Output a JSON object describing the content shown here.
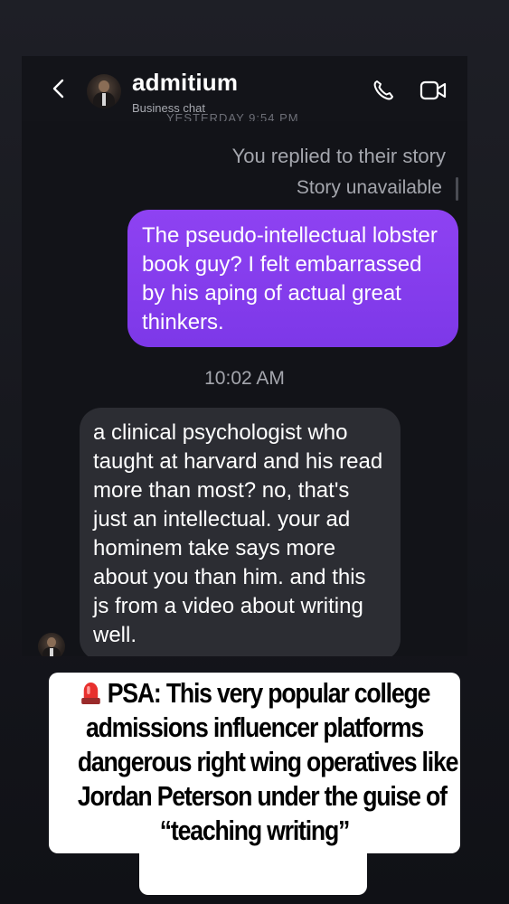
{
  "header": {
    "title": "admitium",
    "subtitle": "Business chat",
    "clipped_date": "YESTERDAY 9:54 PM"
  },
  "thread": {
    "reply_note": "You replied to their story",
    "story_status": "Story unavailable",
    "outgoing_message": "The pseudo-intellectual lobster book guy? I felt embarrassed by his aping of actual great thinkers.",
    "timestamp": "10:02 AM",
    "incoming_message": "a clinical psychologist who taught at harvard and his read more than most? no, that's just an intellectual. your ad hominem take says more about you than him. and this js from a video about writing well."
  },
  "caption": {
    "lines": [
      "PSA: This very popular college",
      "admissions influencer platforms",
      "dangerous right wing  operatives like",
      "Jordan Peterson under the guise of",
      "“teaching writing”"
    ],
    "emoji": "siren-emoji"
  },
  "colors": {
    "outgoing_bubble": "#8e42f2",
    "incoming_bubble": "#2c2d33",
    "background": "#16171d"
  }
}
